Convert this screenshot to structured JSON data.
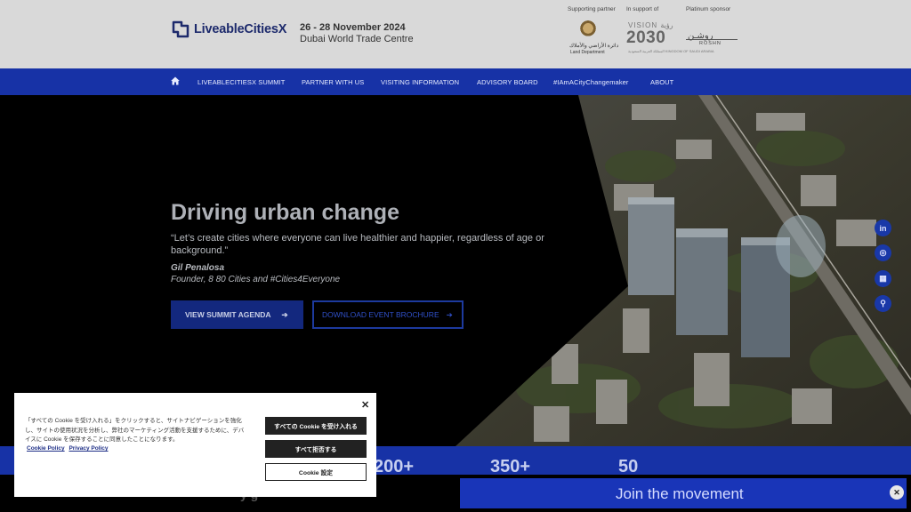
{
  "header": {
    "logo_text": "LiveableCitiesX",
    "event_date": "26 - 28 November 2024",
    "event_venue": "Dubai World Trade Centre",
    "sponsors": {
      "supporting_label": "Supporting partner",
      "support_label": "In support of",
      "platinum_label": "Platinum sponsor",
      "seal_ar": "دائرة الأراضي والأملاك",
      "seal_en": "Land Department",
      "vision_top": "VISION رؤية",
      "vision_num": "2030",
      "vision_sub": "المملكة العربية السعودية KINGDOM OF SAUDI ARABIA",
      "roshn_ar": "روشـن",
      "roshn_en": "ROSHN"
    }
  },
  "nav": {
    "home_icon": "home-icon",
    "items": [
      "LIVEABLECITIESX SUMMIT",
      "PARTNER WITH US",
      "VISITING INFORMATION",
      "ADVISORY BOARD",
      "#IAmACityChangemaker",
      "ABOUT"
    ]
  },
  "hero": {
    "title": "Driving urban change",
    "quote": "“Let’s create cities where everyone can live healthier and happier, regardless of age or background.”",
    "author": "Gil Penalosa",
    "role": "Founder, 8 80 Cities and #Cities4Everyone",
    "primary_button": "VIEW SUMMIT AGENDA",
    "secondary_button": "DOWNLOAD EVENT BROCHURE",
    "arrow": "➔"
  },
  "social": [
    {
      "icon": "linkedin-icon",
      "glyph": "in"
    },
    {
      "icon": "instagram-icon",
      "glyph": "◎"
    },
    {
      "icon": "calendar-icon",
      "glyph": "▦"
    },
    {
      "icon": "search-icon",
      "glyph": "⚲"
    }
  ],
  "stats": [
    "200+",
    "350+",
    "50"
  ],
  "partial_text": "y   g",
  "join": {
    "label": "Join the movement",
    "close": "✕"
  },
  "cookie": {
    "close": "✕",
    "text": "「すべての Cookie を受け入れる」をクリックすると、サイトナビゲーションを強化し、サイトの使用状況を分析し、弊社のマーケティング活動を支援するために、デバイスに Cookie を保存することに同意したことになります。",
    "link_policy": "Cookie Policy",
    "link_privacy": "Privacy Policy",
    "accept_all": "すべての Cookie を受け入れる",
    "reject_all": "すべて拒否する",
    "settings": "Cookie 設定"
  },
  "colors": {
    "nav_blue": "#1732a6",
    "header_bg": "#d9d9d9",
    "cookie_button": "#222222"
  }
}
